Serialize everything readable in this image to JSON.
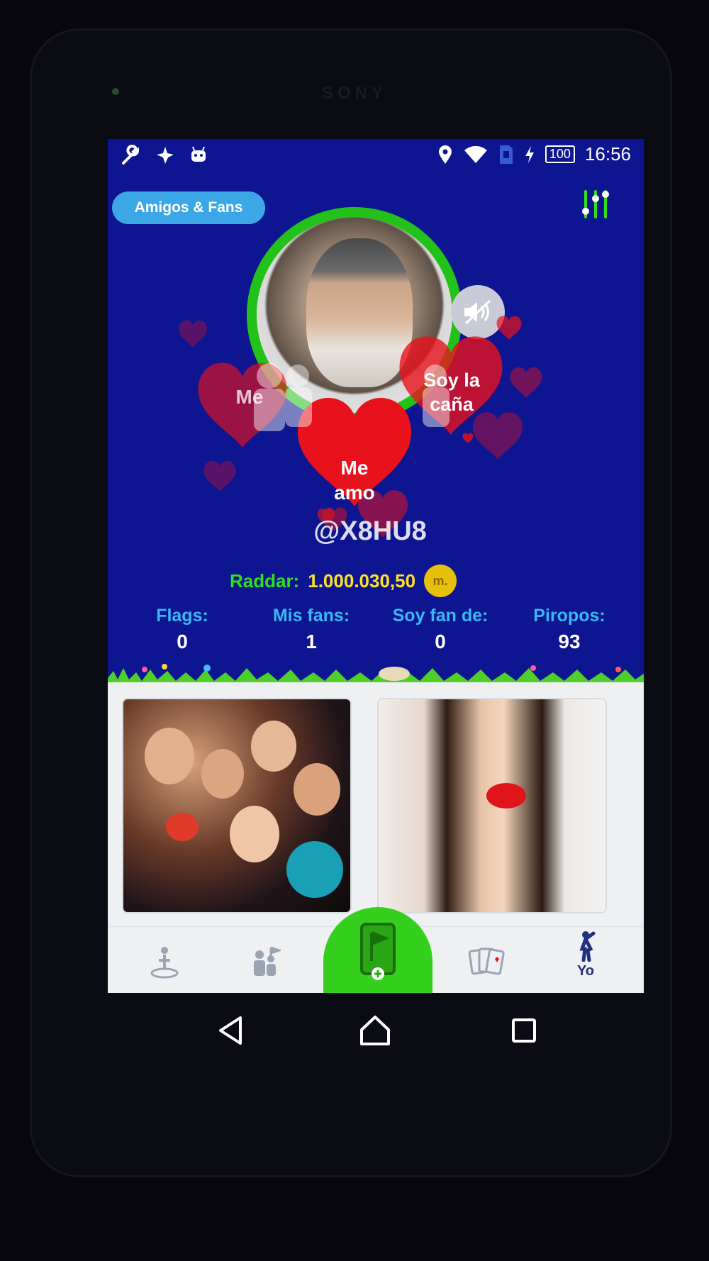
{
  "device": {
    "brand": "SONY"
  },
  "status_bar": {
    "left_icons": [
      "wrench-icon",
      "pin-star-icon",
      "android-icon"
    ],
    "right_icons": [
      "location-icon",
      "wifi-icon",
      "sim-icon",
      "charging-icon"
    ],
    "battery": "100",
    "time": "16:56"
  },
  "header": {
    "friends_button": "Amigos & Fans",
    "settings_icon": "sliders-icon"
  },
  "profile": {
    "avatar_border_color": "#23c21b",
    "mute_icon": "speaker-muted-icon",
    "username": "@X8HU8",
    "hearts": {
      "left": "Me",
      "center": "Me\namo",
      "right": "Soy la\ncaña"
    },
    "raddar_label": "Raddar:",
    "raddar_value": "1.000.030,50",
    "coin_label": "m."
  },
  "stats": [
    {
      "label": "Flags:",
      "value": "0"
    },
    {
      "label": "Mis fans:",
      "value": "1"
    },
    {
      "label": "Soy fan de:",
      "value": "0"
    },
    {
      "label": "Piropos:",
      "value": "93"
    }
  ],
  "navbar": {
    "items": [
      "location-person-icon",
      "fans-flag-icon",
      "add-flag-phone-icon",
      "cards-icon",
      "person-icon"
    ],
    "active_label": "Yo",
    "center_color": "#35cf1e"
  },
  "colors": {
    "screen_bg": "#0d1591",
    "friends_button": "#3ba7e6",
    "raddar_label": "#2ee01a",
    "raddar_value": "#ffe02a",
    "stat_label": "#3ab7f2",
    "heart": "#e8121c"
  }
}
